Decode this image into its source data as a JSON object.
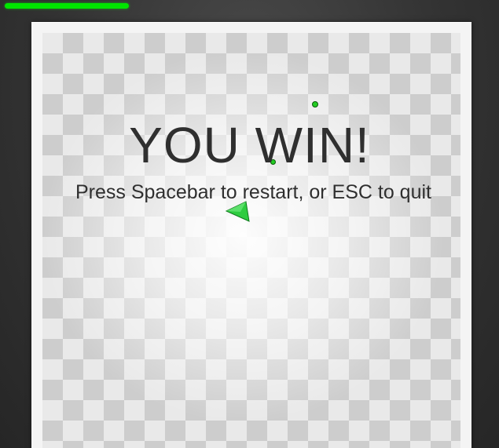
{
  "hud": {
    "health_fraction": 1.0,
    "health_color": "#00e600"
  },
  "overlay": {
    "title": "YOU WIN!",
    "subtitle": "Press Spacebar to restart, or ESC to quit"
  },
  "colors": {
    "background": "#333333",
    "arena_frame": "#f4f4f4",
    "checker_dark": "#cdcdcd",
    "checker_light": "#e9e9e9",
    "text": "#2f2f2f",
    "player": "#2ecc40",
    "orb": "#22cc22"
  },
  "icons": {
    "player": "triangle-ship-icon",
    "orb": "green-orb-icon"
  }
}
